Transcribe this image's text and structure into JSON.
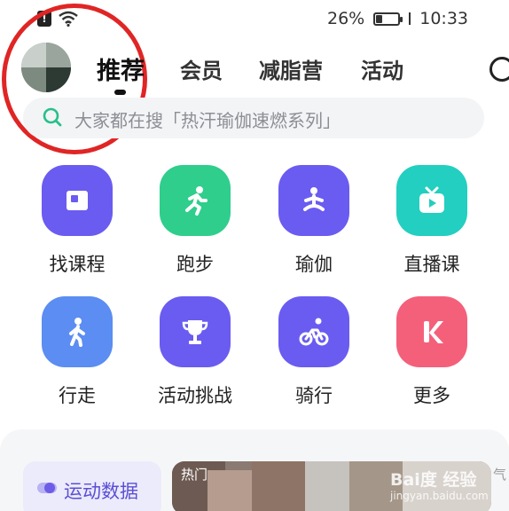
{
  "status_bar": {
    "alert_icon": "sim-alert-icon",
    "wifi_icon": "wifi-icon",
    "battery_percent": "26%",
    "battery_level": 0.26,
    "time": "10:33"
  },
  "nav": {
    "tabs": [
      {
        "label": "推荐",
        "active": true
      },
      {
        "label": "会员",
        "active": false
      },
      {
        "label": "减脂营",
        "active": false
      },
      {
        "label": "活动",
        "active": false
      }
    ],
    "search_icon": "search-icon"
  },
  "search": {
    "placeholder": "大家都在搜「热汗瑜伽速燃系列」"
  },
  "grid": [
    {
      "label": "找课程",
      "icon": "course-card-icon",
      "color": "#6a5cf0"
    },
    {
      "label": "跑步",
      "icon": "running-icon",
      "color": "#2fce8c"
    },
    {
      "label": "瑜伽",
      "icon": "yoga-icon",
      "color": "#6a5cf0"
    },
    {
      "label": "直播课",
      "icon": "live-tv-icon",
      "color": "#22cfc0"
    },
    {
      "label": "行走",
      "icon": "walking-icon",
      "color": "#5b8df2"
    },
    {
      "label": "活动挑战",
      "icon": "trophy-icon",
      "color": "#6a5cf0"
    },
    {
      "label": "骑行",
      "icon": "cycling-icon",
      "color": "#6a5cf0"
    },
    {
      "label": "更多",
      "icon": "k-logo-icon",
      "color": "#f4607a"
    }
  ],
  "bottom": {
    "sport_data_label": "运动数据",
    "hot_tag": "热门",
    "side_tag": "气"
  },
  "watermark": {
    "main": "Bai度 经验",
    "sub": "jingyan.baidu.com"
  }
}
